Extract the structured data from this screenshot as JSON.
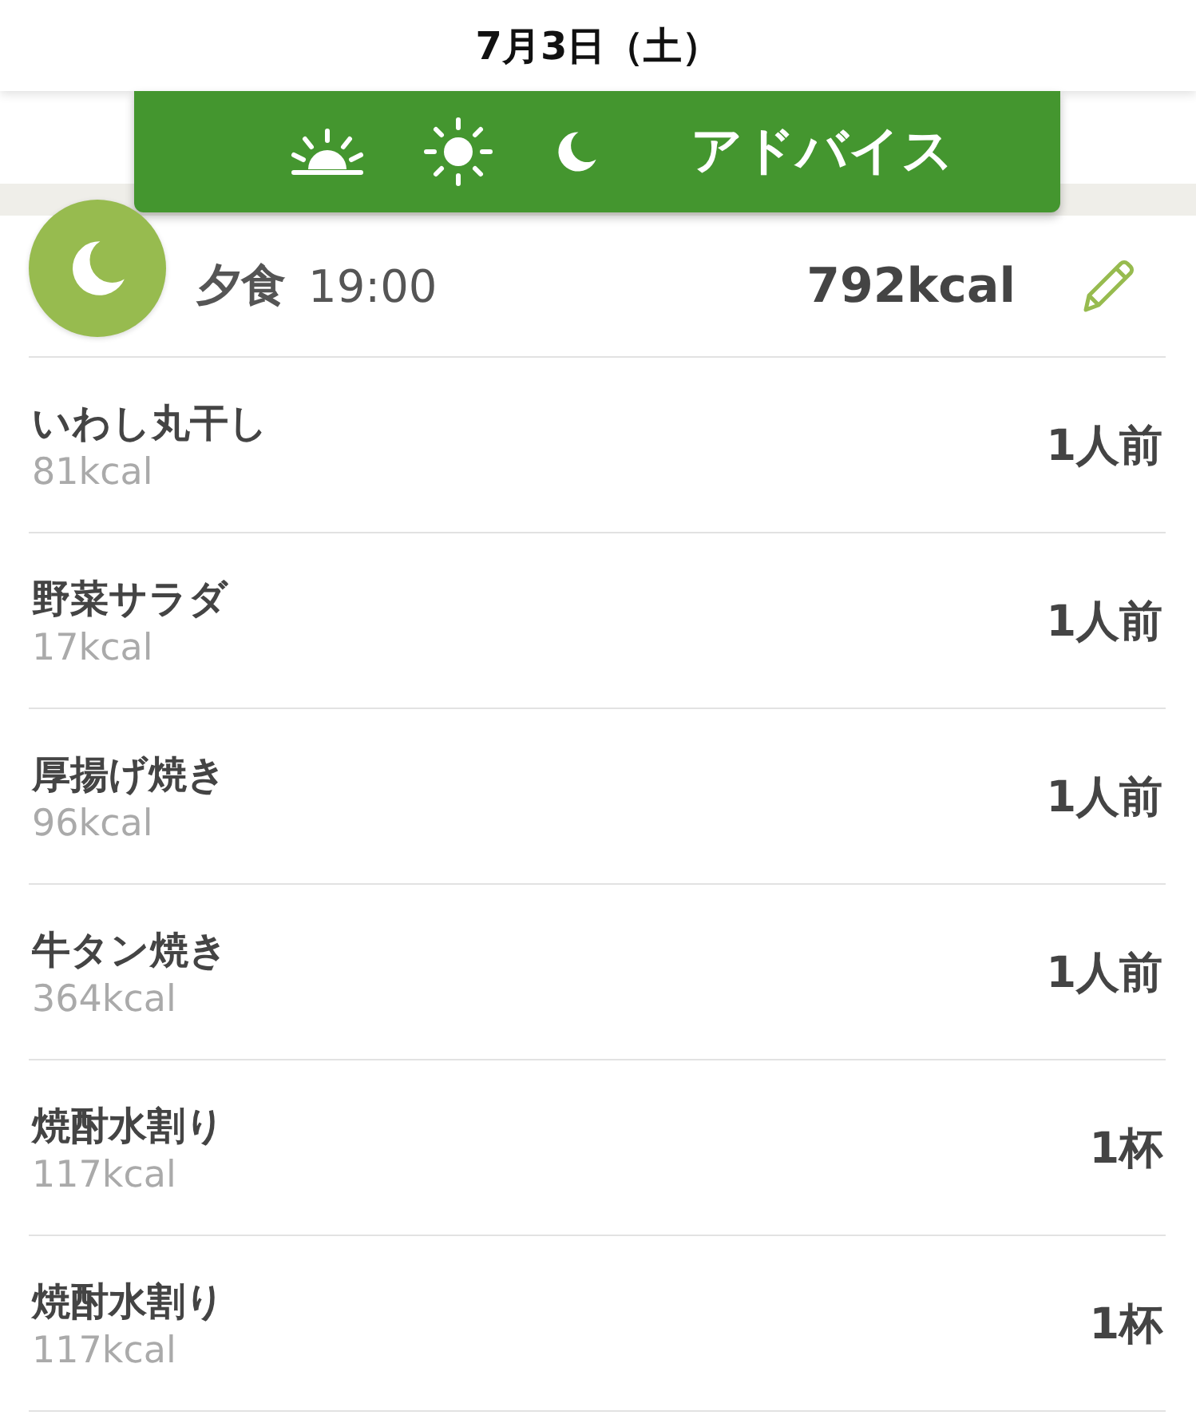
{
  "header": {
    "title": "7月3日（土）"
  },
  "tab_bar": {
    "advice_label": "アドバイス"
  },
  "meal": {
    "name": "夕食",
    "time": "19:00",
    "total": "792kcal"
  },
  "items": [
    {
      "name": "いわし丸干し",
      "kcal": "81kcal",
      "portion": "1人前"
    },
    {
      "name": "野菜サラダ",
      "kcal": "17kcal",
      "portion": "1人前"
    },
    {
      "name": "厚揚げ焼き",
      "kcal": "96kcal",
      "portion": "1人前"
    },
    {
      "name": "牛タン焼き",
      "kcal": "364kcal",
      "portion": "1人前"
    },
    {
      "name": "焼酎水割り",
      "kcal": "117kcal",
      "portion": "1杯"
    },
    {
      "name": "焼酎水割り",
      "kcal": "117kcal",
      "portion": "1杯"
    }
  ]
}
